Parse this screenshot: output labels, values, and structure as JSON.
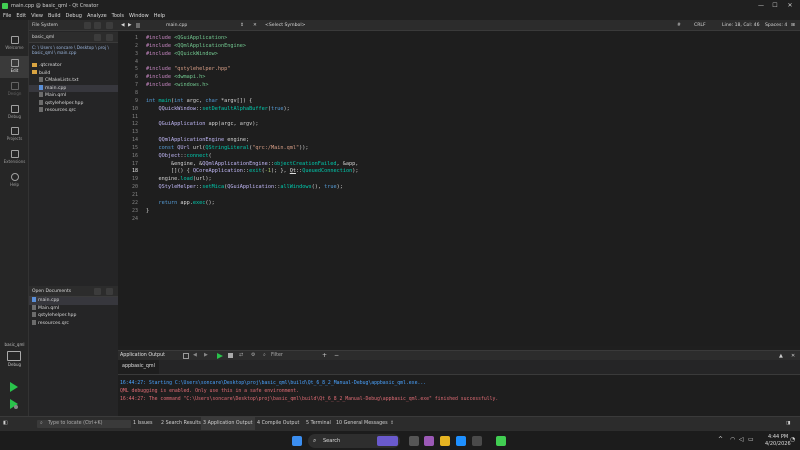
{
  "window": {
    "title": "main.cpp @ basic_qml - Qt Creator",
    "minimize_glyph": "—",
    "maximize_glyph": "☐",
    "close_glyph": "✕"
  },
  "menu": [
    "File",
    "Edit",
    "View",
    "Build",
    "Debug",
    "Analyze",
    "Tools",
    "Window",
    "Help"
  ],
  "modes": [
    {
      "label": "Welcome",
      "icon": "welcome-icon"
    },
    {
      "label": "Edit",
      "icon": "edit-icon"
    },
    {
      "label": "Design",
      "icon": "design-icon"
    },
    {
      "label": "Debug",
      "icon": "debug-icon"
    },
    {
      "label": "Projects",
      "icon": "projects-icon"
    },
    {
      "label": "Extensions",
      "icon": "extensions-icon"
    },
    {
      "label": "Help",
      "icon": "help-icon"
    }
  ],
  "target": {
    "project": "basic_qml",
    "config": "Debug"
  },
  "sidepanel": {
    "view_combo": "File System",
    "project_combo": "basic_qml",
    "breadcrumb": "C: \\ Users \\ soncare \\ Desktop \\ proj \\ basic_qml \\ main.cpp",
    "tree": [
      {
        "label": ".qtcreator",
        "type": "folder"
      },
      {
        "label": "build",
        "type": "folder"
      },
      {
        "label": "CMakeLists.txt",
        "type": "file"
      },
      {
        "label": "main.cpp",
        "type": "file",
        "selected": true
      },
      {
        "label": "Main.qml",
        "type": "file"
      },
      {
        "label": "qstylehelper.hpp",
        "type": "file"
      },
      {
        "label": "resources.qrc",
        "type": "file"
      }
    ],
    "open_docs_combo": "Open Documents",
    "open_docs": [
      {
        "label": "main.cpp",
        "selected": true
      },
      {
        "label": "Main.qml"
      },
      {
        "label": "qstylehelper.hpp"
      },
      {
        "label": "resources.qrc"
      }
    ]
  },
  "editor": {
    "file_tab": "main.cpp",
    "symbol": "<Select Symbol>",
    "encoding_hash": "#",
    "line_ending": "CRLF",
    "position": "Line: 18, Col: 46",
    "indent": "Spaces: 4",
    "current_line": 18
  },
  "output": {
    "pane_title": "Application Output",
    "filter_placeholder": "Filter",
    "run_tab": "appbasic_qml",
    "lines": [
      {
        "text": "16:44:27: Starting C:\\Users\\soncare\\Desktop\\proj\\basic_qml\\build\\Qt_6_8_2_Manual-Debug\\appbasic_qml.exe...",
        "color": "#4aa3ff"
      },
      {
        "text": "QML debugging is enabled. Only use this in a safe environment.",
        "color": "#e06c75"
      },
      {
        "text": "16:44:27: The command \"C:\\Users\\soncare\\Desktop\\proj\\basic_qml\\build\\Qt_6_8_2_Manual-Debug\\appbasic_qml.exe\" finished successfully.",
        "color": "#e06c75"
      }
    ]
  },
  "statusbar": {
    "locate_placeholder": "Type to locate (Ctrl+K)",
    "tabs": [
      "1 Issues",
      "2 Search Results",
      "3 Application Output",
      "4 Compile Output",
      "5 Terminal",
      "10 General Messages"
    ],
    "active_tab": "3 Application Output"
  },
  "taskbar": {
    "search": "Search",
    "time": "4:44 PM",
    "date": "4/20/2026"
  },
  "colors": {
    "accent_green": "#41cd52",
    "run_green": "#29c34b",
    "editor_bg": "#1e1e1e"
  }
}
